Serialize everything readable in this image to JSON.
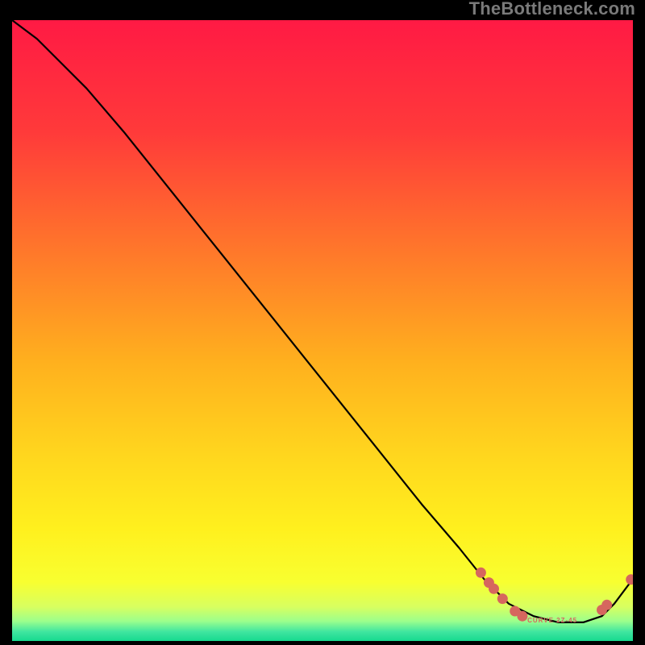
{
  "watermark": "TheBottleneck.com",
  "curve_label": "CURVE 2Z-45",
  "colors": {
    "bg": "#000000",
    "curve": "#000000",
    "marker": "#d6665e",
    "watermark": "#7a7a7a",
    "gradient_stops": [
      {
        "offset": 0.0,
        "color": "#ff1a44"
      },
      {
        "offset": 0.18,
        "color": "#ff3a3a"
      },
      {
        "offset": 0.38,
        "color": "#ff7a2a"
      },
      {
        "offset": 0.55,
        "color": "#ffb01e"
      },
      {
        "offset": 0.7,
        "color": "#ffd61e"
      },
      {
        "offset": 0.82,
        "color": "#fff01e"
      },
      {
        "offset": 0.905,
        "color": "#f8ff30"
      },
      {
        "offset": 0.945,
        "color": "#d8ff60"
      },
      {
        "offset": 0.968,
        "color": "#9cff8c"
      },
      {
        "offset": 0.985,
        "color": "#40e6a0"
      },
      {
        "offset": 1.0,
        "color": "#17d98f"
      }
    ]
  },
  "chart_data": {
    "type": "line",
    "title": "",
    "xlabel": "",
    "ylabel": "",
    "xlim": [
      0,
      100
    ],
    "ylim": [
      0,
      100
    ],
    "grid": false,
    "legend": false,
    "note": "Axes unlabeled in source image; values are normalized 0–100 estimates read from pixel geometry.",
    "series": [
      {
        "name": "curve",
        "x": [
          0,
          4,
          8,
          12,
          18,
          26,
          34,
          42,
          50,
          58,
          66,
          72,
          76,
          80,
          84,
          88,
          92,
          95,
          97,
          100
        ],
        "y": [
          100,
          97,
          93,
          89,
          82,
          72,
          62,
          52,
          42,
          32,
          22,
          15,
          10,
          6,
          4,
          3,
          3,
          4,
          6,
          10
        ]
      }
    ],
    "markers": [
      {
        "x": 75.5,
        "y": 11.0
      },
      {
        "x": 76.8,
        "y": 9.4
      },
      {
        "x": 77.6,
        "y": 8.4
      },
      {
        "x": 79.0,
        "y": 6.8
      },
      {
        "x": 81.0,
        "y": 4.8
      },
      {
        "x": 82.2,
        "y": 4.0
      },
      {
        "x": 95.0,
        "y": 5.0
      },
      {
        "x": 95.8,
        "y": 5.8
      },
      {
        "x": 99.7,
        "y": 9.9
      }
    ]
  }
}
